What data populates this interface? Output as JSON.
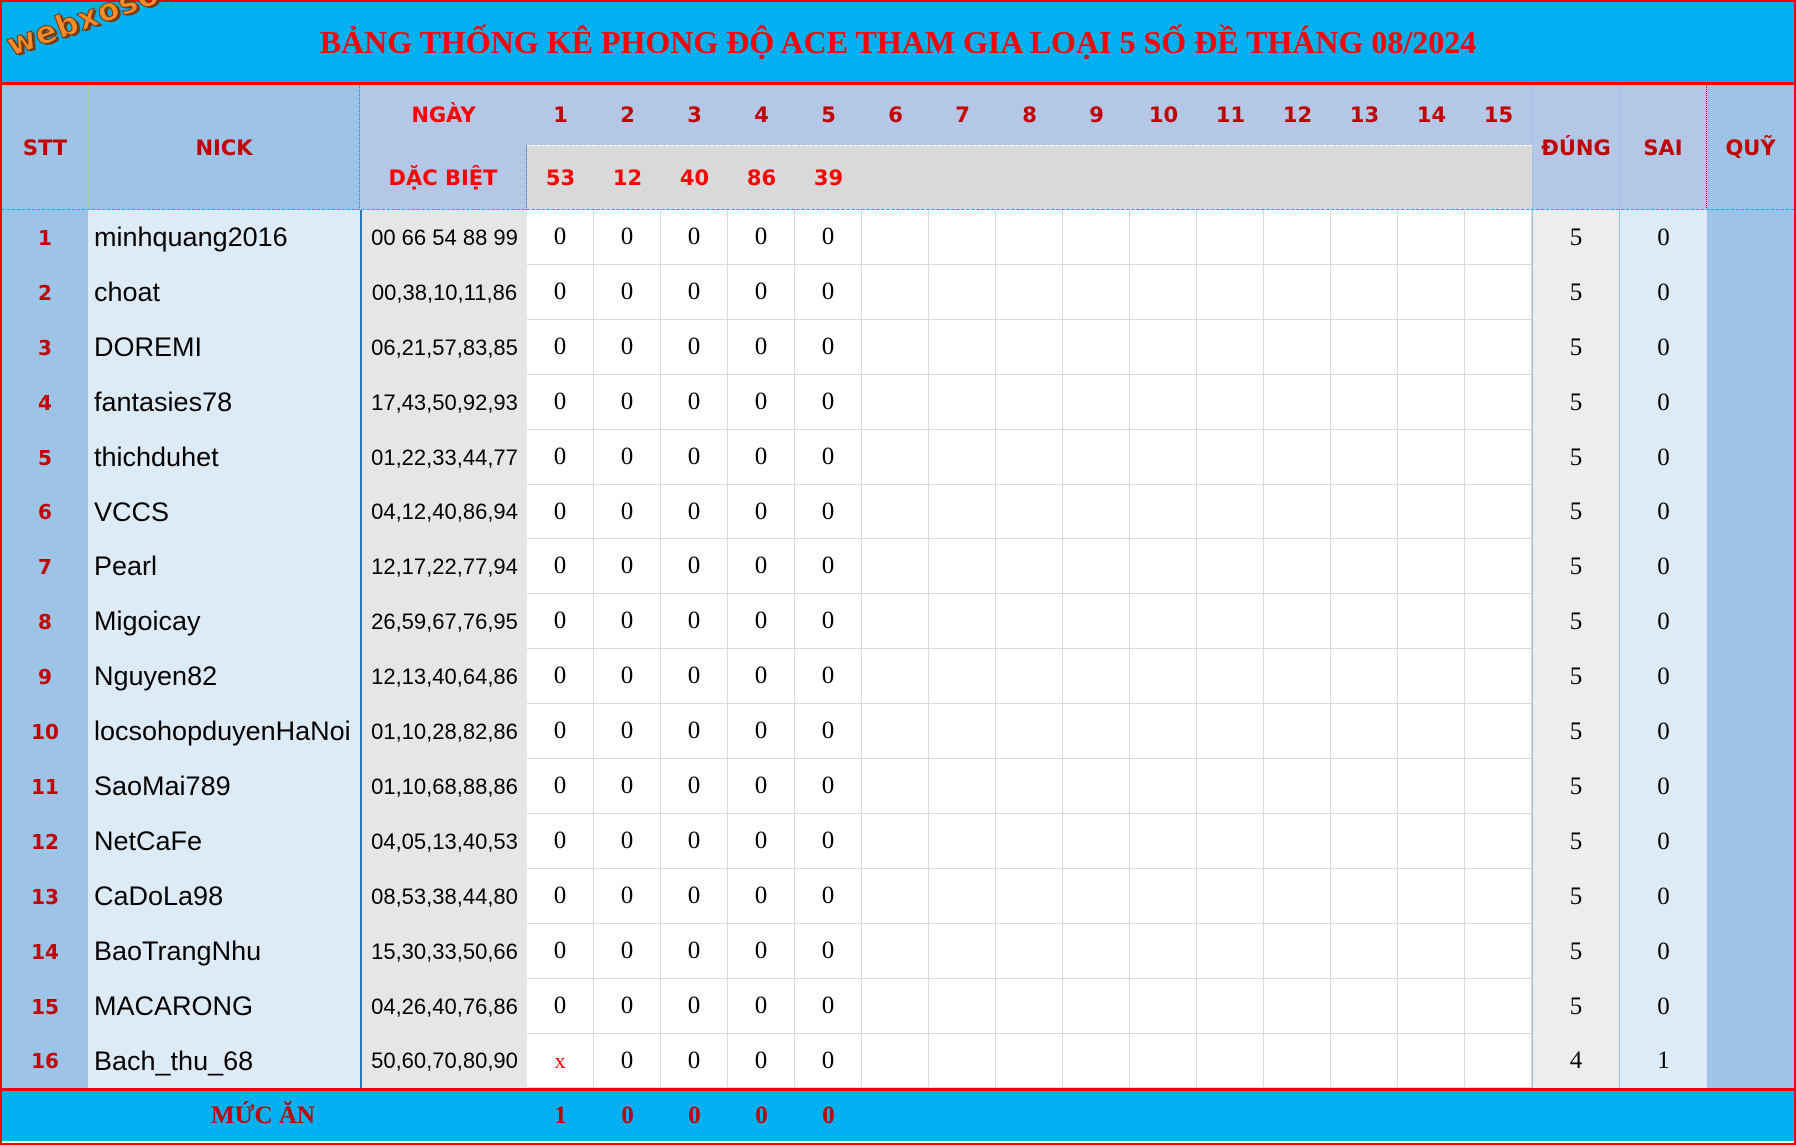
{
  "header": {
    "title": "BẢNG THỐNG KÊ PHONG ĐỘ ACE THAM GIA LOẠI 5 SỐ ĐỀ THÁNG 08/2024",
    "logo": "webxoso.net",
    "col_stt": "STT",
    "col_nick": "NICK",
    "col_ngay": "NGÀY",
    "col_dac_biet": "DẶC BIỆT",
    "col_dung": "ĐÚNG",
    "col_sai": "SAI",
    "col_quy": "QUỸ",
    "days": [
      "1",
      "2",
      "3",
      "4",
      "5",
      "6",
      "7",
      "8",
      "9",
      "10",
      "11",
      "12",
      "13",
      "14",
      "15"
    ],
    "special_results": [
      "53",
      "12",
      "40",
      "86",
      "39",
      "",
      "",
      "",
      "",
      "",
      "",
      "",
      "",
      "",
      ""
    ]
  },
  "rows": [
    {
      "stt": "1",
      "nick": "minhquang2016",
      "numbers": "00 66 54 88 99",
      "days": [
        "0",
        "0",
        "0",
        "0",
        "0"
      ],
      "dung": "5",
      "sai": "0"
    },
    {
      "stt": "2",
      "nick": "choat",
      "numbers": "00,38,10,11,86",
      "days": [
        "0",
        "0",
        "0",
        "0",
        "0"
      ],
      "dung": "5",
      "sai": "0"
    },
    {
      "stt": "3",
      "nick": "DOREMI",
      "numbers": "06,21,57,83,85",
      "days": [
        "0",
        "0",
        "0",
        "0",
        "0"
      ],
      "dung": "5",
      "sai": "0"
    },
    {
      "stt": "4",
      "nick": "fantasies78",
      "numbers": "17,43,50,92,93",
      "days": [
        "0",
        "0",
        "0",
        "0",
        "0"
      ],
      "dung": "5",
      "sai": "0"
    },
    {
      "stt": "5",
      "nick": "thichduhet",
      "numbers": "01,22,33,44,77",
      "days": [
        "0",
        "0",
        "0",
        "0",
        "0"
      ],
      "dung": "5",
      "sai": "0"
    },
    {
      "stt": "6",
      "nick": "VCCS",
      "numbers": "04,12,40,86,94",
      "days": [
        "0",
        "0",
        "0",
        "0",
        "0"
      ],
      "dung": "5",
      "sai": "0"
    },
    {
      "stt": "7",
      "nick": "Pearl",
      "numbers": "12,17,22,77,94",
      "days": [
        "0",
        "0",
        "0",
        "0",
        "0"
      ],
      "dung": "5",
      "sai": "0"
    },
    {
      "stt": "8",
      "nick": "Migoicay",
      "numbers": "26,59,67,76,95",
      "days": [
        "0",
        "0",
        "0",
        "0",
        "0"
      ],
      "dung": "5",
      "sai": "0"
    },
    {
      "stt": "9",
      "nick": "Nguyen82",
      "numbers": "12,13,40,64,86",
      "days": [
        "0",
        "0",
        "0",
        "0",
        "0"
      ],
      "dung": "5",
      "sai": "0"
    },
    {
      "stt": "10",
      "nick": "locsohopduyenHaNoi",
      "numbers": "01,10,28,82,86",
      "days": [
        "0",
        "0",
        "0",
        "0",
        "0"
      ],
      "dung": "5",
      "sai": "0"
    },
    {
      "stt": "11",
      "nick": "SaoMai789",
      "numbers": "01,10,68,88,86",
      "days": [
        "0",
        "0",
        "0",
        "0",
        "0"
      ],
      "dung": "5",
      "sai": "0"
    },
    {
      "stt": "12",
      "nick": "NetCaFe",
      "numbers": "04,05,13,40,53",
      "days": [
        "0",
        "0",
        "0",
        "0",
        "0"
      ],
      "dung": "5",
      "sai": "0"
    },
    {
      "stt": "13",
      "nick": "CaDoLa98",
      "numbers": "08,53,38,44,80",
      "days": [
        "0",
        "0",
        "0",
        "0",
        "0"
      ],
      "dung": "5",
      "sai": "0"
    },
    {
      "stt": "14",
      "nick": "BaoTrangNhu",
      "numbers": "15,30,33,50,66",
      "days": [
        "0",
        "0",
        "0",
        "0",
        "0"
      ],
      "dung": "5",
      "sai": "0"
    },
    {
      "stt": "15",
      "nick": "MACARONG",
      "numbers": "04,26,40,76,86",
      "days": [
        "0",
        "0",
        "0",
        "0",
        "0"
      ],
      "dung": "5",
      "sai": "0"
    },
    {
      "stt": "16",
      "nick": "Bach_thu_68",
      "numbers": "50,60,70,80,90",
      "days": [
        "x",
        "0",
        "0",
        "0",
        "0"
      ],
      "dung": "4",
      "sai": "1"
    }
  ],
  "footer": {
    "label": "MỨC ĂN",
    "values": [
      "1",
      "0",
      "0",
      "0",
      "0"
    ]
  },
  "colors": {
    "title_bg": "#00b0f0",
    "title_text": "#ff0000",
    "header_text": "#c00000",
    "border": "#ff0000"
  }
}
